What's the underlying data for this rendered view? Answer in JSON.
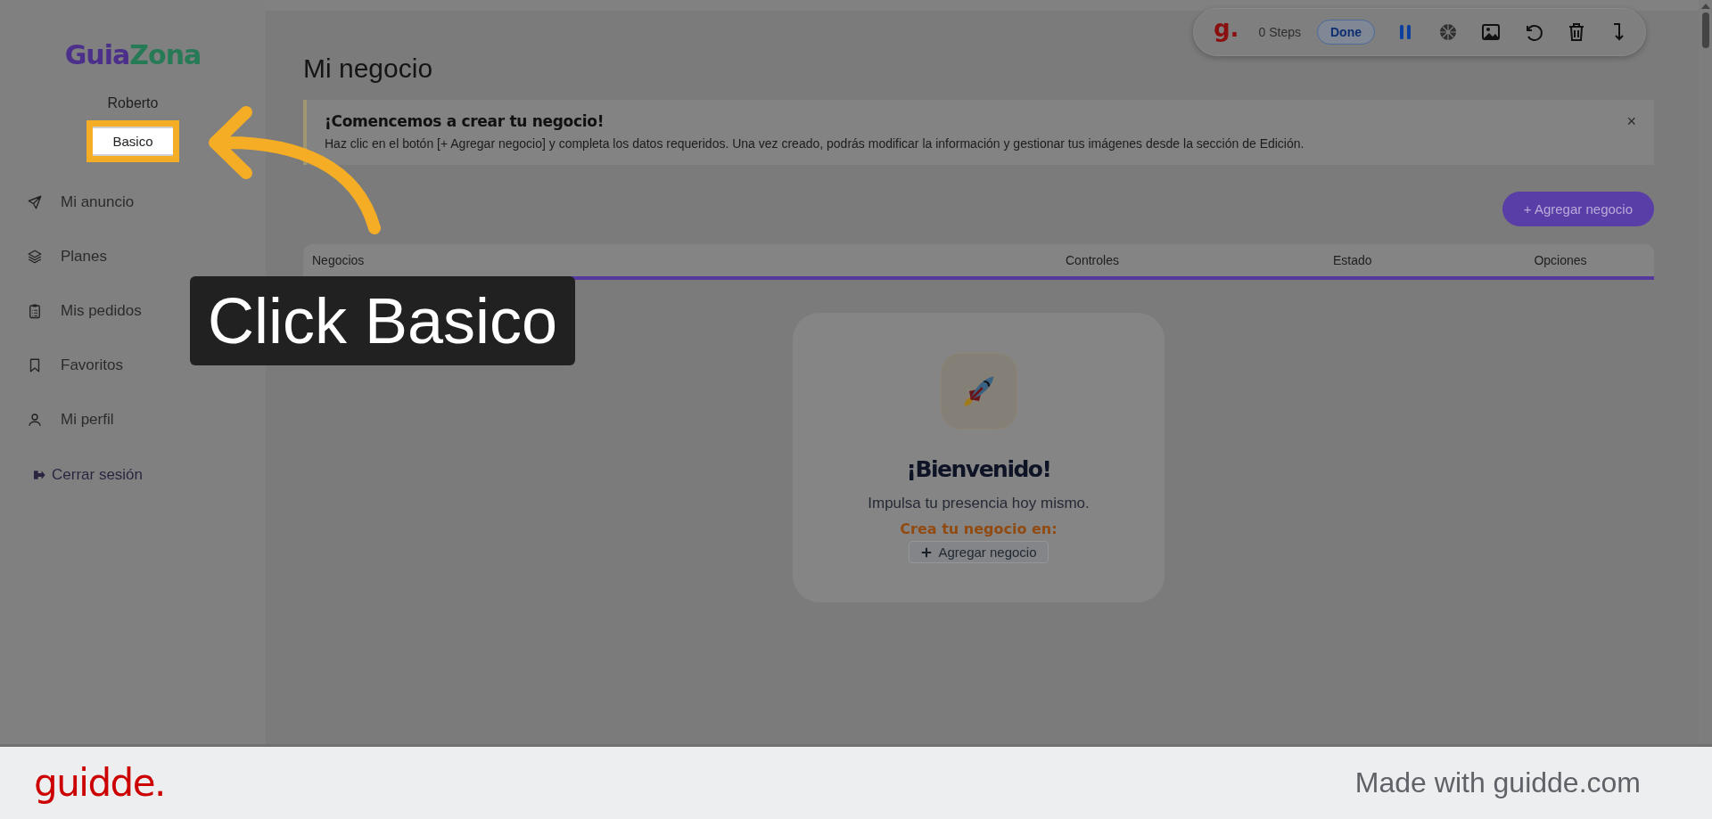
{
  "sidebar": {
    "logo": {
      "left": "Guia",
      "right": "Zona"
    },
    "user_name": "Roberto",
    "plan_button": {
      "label": "Basico",
      "highlighted": true
    },
    "nav_items": [
      {
        "kind": "send",
        "label": "Mi anuncio"
      },
      {
        "kind": "layers",
        "label": "Planes"
      },
      {
        "kind": "clipboard",
        "label": "Mis pedidos"
      },
      {
        "kind": "bookmark",
        "label": "Favoritos"
      },
      {
        "kind": "user",
        "label": "Mi perfil"
      }
    ],
    "logout": "Cerrar sesión"
  },
  "main": {
    "title": "Mi negocio",
    "banner": {
      "title": "¡Comencemos a crear tu negocio!",
      "text": "Haz clic en el botón [+ Agregar negocio] y completa los datos requeridos. Una vez creado, podrás modificar la información y gestionar tus imágenes desde la sección de Edición.",
      "close": "×"
    },
    "add_button": "+ Agregar negocio",
    "table": {
      "columns": [
        "Negocios",
        "Controles",
        "Estado",
        "Opciones"
      ]
    },
    "empty_state": {
      "title": "¡Bienvenido!",
      "subtitle": "Impulsa tu presencia hoy mismo.",
      "prompt": "Crea tu negocio en:",
      "button": "Agregar negocio"
    }
  },
  "recorder": {
    "logo": "g.",
    "steps": "0 Steps",
    "done": "Done"
  },
  "callout": {
    "text": "Click Basico"
  },
  "footer": {
    "brand": "guidde.",
    "credit": "Made with guidde.com"
  }
}
